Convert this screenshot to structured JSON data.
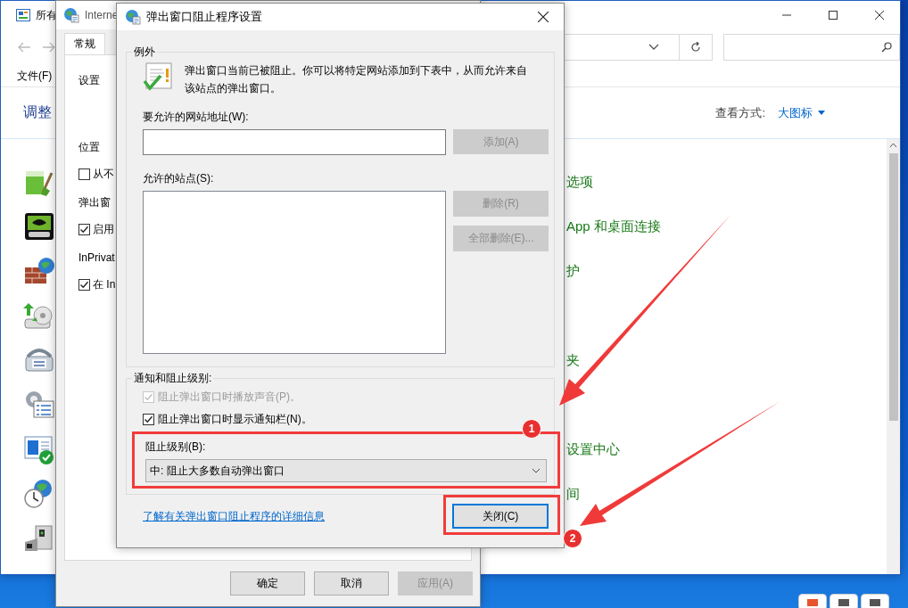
{
  "control_panel": {
    "title": "所有",
    "menu": [
      "文件(F)"
    ],
    "heading": "调整",
    "view_label": "查看方式:",
    "view_value": "大图标",
    "items": [
      {
        "kind": "link",
        "label": "选项"
      },
      {
        "kind": "link",
        "label": "App 和桌面连接"
      },
      {
        "kind": "link",
        "label": "护"
      },
      {
        "kind": "icon"
      },
      {
        "kind": "link",
        "label": "夹"
      },
      {
        "kind": "icon"
      },
      {
        "kind": "link",
        "label": "设置中心"
      },
      {
        "kind": "link",
        "label": "间"
      },
      {
        "kind": "icon"
      }
    ]
  },
  "internet_options": {
    "title": "Interne",
    "tabs": [
      {
        "label": "常规",
        "selected": true
      }
    ],
    "sections": [
      {
        "kind": "heading",
        "label": "设置"
      },
      {
        "kind": "heading",
        "label": "位置"
      },
      {
        "kind": "checkbox",
        "label": "从不",
        "checked": false
      },
      {
        "kind": "heading",
        "label": "弹出窗"
      },
      {
        "kind": "checkbox",
        "label": "启用",
        "checked": true
      },
      {
        "kind": "heading",
        "label": "InPrivat"
      },
      {
        "kind": "checkbox",
        "label": "在 In",
        "checked": true
      }
    ],
    "buttons": [
      {
        "label": "确定",
        "disabled": false
      },
      {
        "label": "取消",
        "disabled": false
      },
      {
        "label": "应用(A)",
        "disabled": true
      }
    ]
  },
  "dialog": {
    "title": "弹出窗口阻止程序设置",
    "exceptions": {
      "legend": "例外",
      "message": "弹出窗口当前已被阻止。你可以将特定网站添加到下表中，从而允许来自该站点的弹出窗口。",
      "address_label": "要允许的网站地址(W):",
      "add_button": {
        "label": "添加(A)",
        "disabled": true
      },
      "sites_label": "允许的站点(S):",
      "remove_button": {
        "label": "删除(R)",
        "disabled": true
      },
      "remove_all_button": {
        "label": "全部删除(E)...",
        "disabled": true
      }
    },
    "notification": {
      "legend": "通知和阻止级别:",
      "options": [
        {
          "label": "阻止弹出窗口时播放声音(P)。",
          "checked": true,
          "disabled": true
        },
        {
          "label": "阻止弹出窗口时显示通知栏(N)。",
          "checked": true,
          "disabled": false
        }
      ],
      "level_label": "阻止级别(B):",
      "level_value": "中: 阻止大多数自动弹出窗口"
    },
    "link": "了解有关弹出窗口阻止程序的详细信息",
    "close_button": "关闭(C)"
  },
  "annotations": [
    {
      "label": "1"
    },
    {
      "label": "2"
    }
  ]
}
